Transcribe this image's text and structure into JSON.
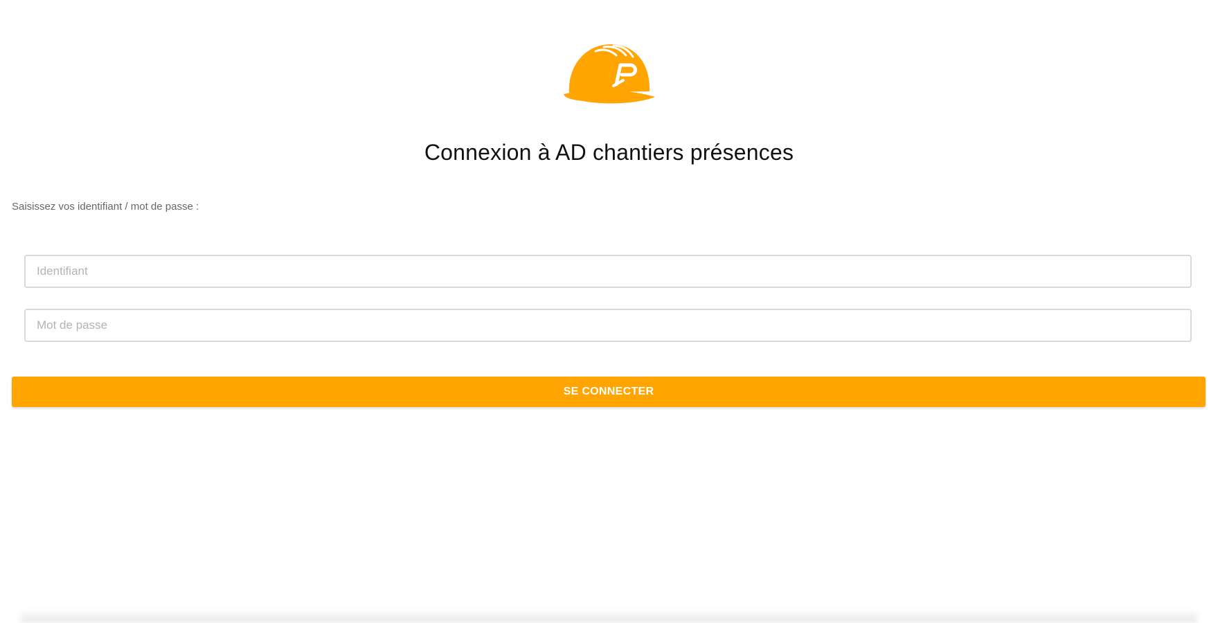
{
  "brand": {
    "logo_icon": "hard-hat-icon",
    "logo_letter": "P",
    "accent_color": "#ffa400"
  },
  "login": {
    "title": "Connexion à AD chantiers présences",
    "instructions": "Saisissez vos identifiant / mot de passe :",
    "username_placeholder": "Identifiant",
    "username_value": "",
    "password_placeholder": "Mot de passe",
    "password_value": "",
    "submit_label": "SE CONNECTER"
  }
}
